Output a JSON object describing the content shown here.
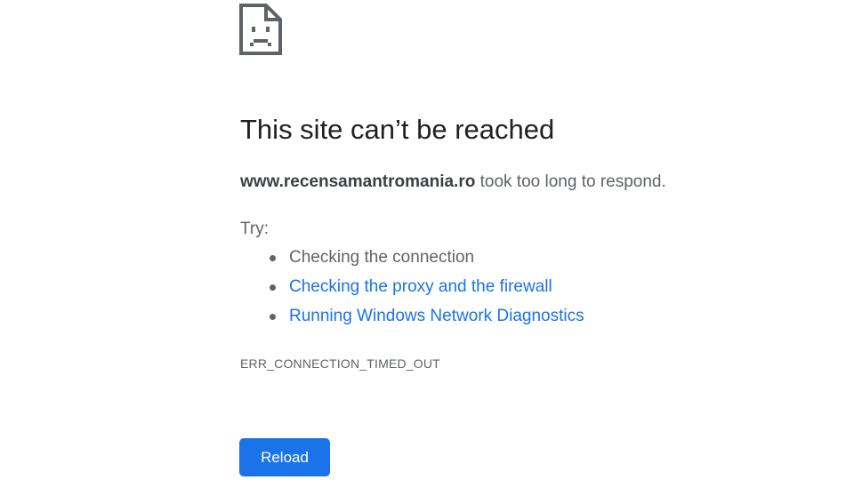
{
  "error_page": {
    "icon": "sad-page-icon",
    "title": "This site can’t be reached",
    "summary": {
      "host": "www.recensamantromania.ro",
      "message": " took too long to respond."
    },
    "try_label": "Try:",
    "suggestions": [
      {
        "label": "Checking the connection",
        "is_link": false
      },
      {
        "label": "Checking the proxy and the firewall",
        "is_link": true
      },
      {
        "label": "Running Windows Network Diagnostics",
        "is_link": true
      }
    ],
    "error_code": "ERR_CONNECTION_TIMED_OUT",
    "reload_label": "Reload"
  },
  "colors": {
    "title": "#202124",
    "body_text": "#5f6368",
    "link": "#1a73e8",
    "button_bg": "#1a73e8",
    "button_text": "#ffffff"
  }
}
